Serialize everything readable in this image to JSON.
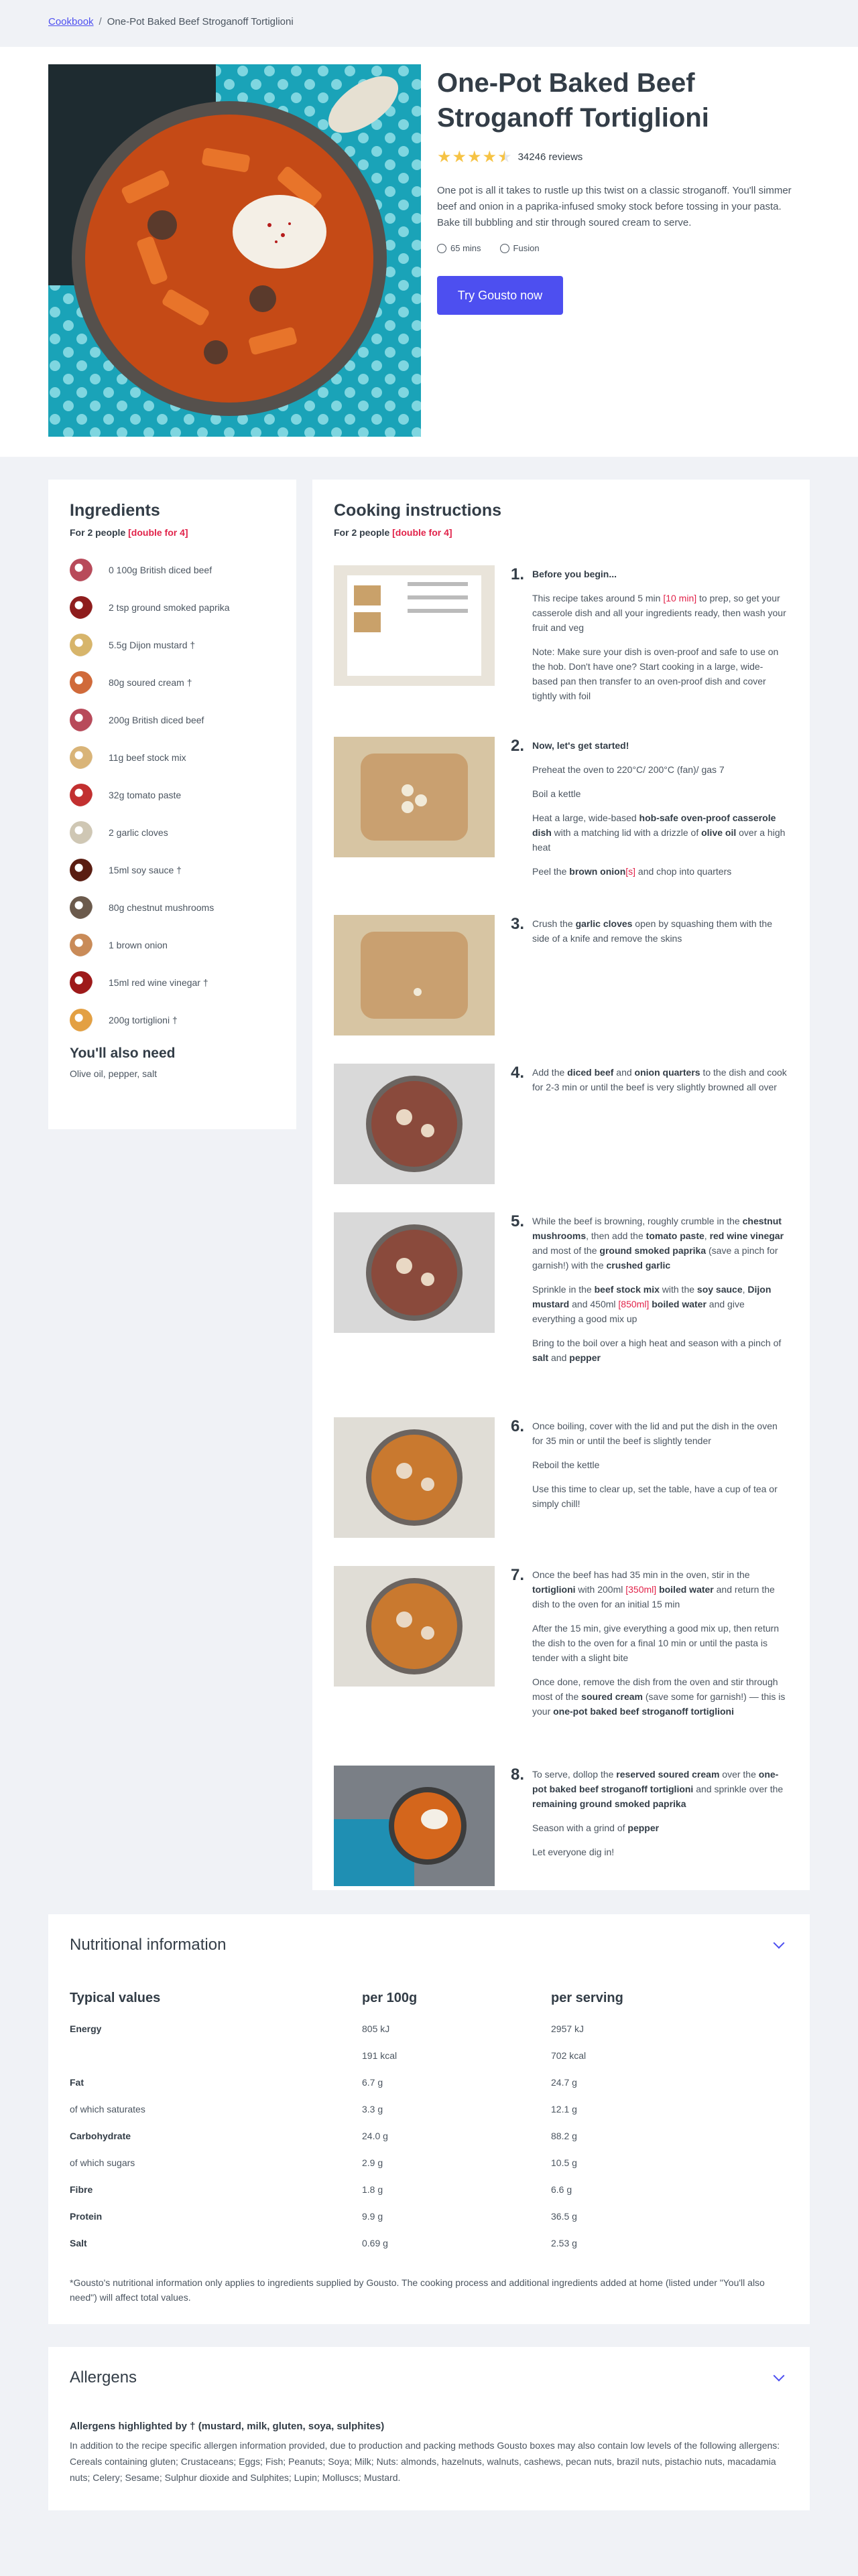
{
  "breadcrumb": {
    "link": "Cookbook",
    "separator": "/",
    "current": "One-Pot Baked Beef Stroganoff Tortiglioni"
  },
  "hero": {
    "title": "One-Pot Baked Beef Stroganoff Tortiglioni",
    "rating": 4.5,
    "reviews": "34246 reviews",
    "description": "One pot is all it takes to rustle up this twist on a classic stroganoff. You'll simmer beef and onion in a paprika-infused smoky stock before tossing in your pasta. Bake till bubbling and stir through soured cream to serve.",
    "time": "65 mins",
    "cuisine": "Fusion",
    "cta": "Try Gousto now"
  },
  "ingredients": {
    "title": "Ingredients",
    "serves": "For 2 people ",
    "double": "[double for 4]",
    "items": [
      {
        "label": "0 100g British diced beef",
        "color": "#b84a5a"
      },
      {
        "label": "2 tsp ground smoked paprika",
        "color": "#8e1d1d"
      },
      {
        "label": "5.5g Dijon mustard †",
        "color": "#d7b56b"
      },
      {
        "label": "80g soured cream †",
        "color": "#d06a3a"
      },
      {
        "label": "200g British diced beef",
        "color": "#b84a5a"
      },
      {
        "label": "11g beef stock mix",
        "color": "#d9b478"
      },
      {
        "label": "32g tomato paste",
        "color": "#c23030"
      },
      {
        "label": "2 garlic cloves",
        "color": "#cfc7b4"
      },
      {
        "label": "15ml soy sauce †",
        "color": "#5a1d12"
      },
      {
        "label": "80g chestnut mushrooms",
        "color": "#6b5a4c"
      },
      {
        "label": "1 brown onion",
        "color": "#c98b58"
      },
      {
        "label": "15ml red wine vinegar †",
        "color": "#9e1a1a"
      },
      {
        "label": "200g tortiglioni †",
        "color": "#e3a043"
      }
    ],
    "also_title": "You'll also need",
    "also_text": "Olive oil, pepper, salt"
  },
  "cooking": {
    "title": "Cooking instructions",
    "serves": "For 2 people ",
    "double": "[double for 4]",
    "steps": [
      {
        "num": "1.",
        "paras": [
          "<b>Before you begin...</b>",
          "This recipe takes around 5 min <span class='hl'>[10 min]</span> to prep, so get your casserole dish and all your ingredients ready, then wash your fruit and veg",
          "Note: Make sure your dish is oven-proof and safe to use on the hob. Don't have one? Start cooking in a large, wide-based pan then transfer to an oven-proof dish and cover tightly with foil"
        ]
      },
      {
        "num": "2.",
        "paras": [
          "<b>Now, let's get started!</b>",
          "Preheat the oven to 220°C/ 200°C (fan)/ gas 7",
          "Boil a kettle",
          "Heat a large, wide-based <b>hob-safe oven-proof casserole dish</b> with a matching lid with a drizzle of <b>olive oil</b> over a high heat",
          "Peel the <b>brown onion</b><span class='hl'>[s]</span> and chop into quarters"
        ]
      },
      {
        "num": "3.",
        "paras": [
          "Crush the <b>garlic cloves</b> open by squashing them with the side of a knife and remove the skins"
        ]
      },
      {
        "num": "4.",
        "paras": [
          "Add the <b>diced beef</b> and <b>onion quarters</b> to the dish and cook for 2-3 min or until the beef is very slightly browned all over"
        ]
      },
      {
        "num": "5.",
        "paras": [
          "While the beef is browning, roughly crumble in the <b>chestnut mushrooms</b>, then add the <b>tomato paste</b>, <b>red wine vinegar</b> and most of the <b>ground smoked paprika</b> (save a pinch for garnish!) with the <b>crushed garlic</b>",
          "Sprinkle in the <b>beef stock mix</b> with the <b>soy sauce</b>, <b>Dijon mustard</b> and 450ml <span class='hl'>[850ml]</span> <b>boiled water</b> and give everything a good mix up",
          "Bring to the boil over a high heat and season with a pinch of <b>salt</b> and <b>pepper</b>"
        ]
      },
      {
        "num": "6.",
        "paras": [
          "Once boiling, cover with the lid and put the dish in the oven for 35 min or until the beef is slightly tender",
          "Reboil the kettle",
          "Use this time to clear up, set the table, have a cup of tea or simply chill!"
        ]
      },
      {
        "num": "7.",
        "paras": [
          "Once the beef has had 35 min in the oven, stir in the <b>tortiglioni</b> with 200ml <span class='hl'>[350ml]</span> <b>boiled water</b> and return the dish to the oven for an initial 15 min",
          "After the 15 min, give everything a good mix up, then return the dish to the oven for a final 10 min or until the pasta is tender with a slight bite",
          "Once done, remove the dish from the oven and stir through most of the <b>soured cream</b> (save some for garnish!) — this is your <b>one-pot baked beef stroganoff tortiglioni</b>"
        ]
      },
      {
        "num": "8.",
        "paras": [
          "To serve, dollop the <b>reserved soured cream</b> over the <b>one-pot baked beef stroganoff tortiglioni</b> and sprinkle over the <b>remaining ground smoked paprika</b>",
          "Season with a grind of <b>pepper</b>",
          "Let everyone dig in!"
        ]
      }
    ]
  },
  "nutrition": {
    "title": "Nutritional information",
    "headers": [
      "Typical values",
      "per 100g",
      "per serving"
    ],
    "rows": [
      {
        "label": "Energy",
        "bold": true,
        "per100": "805 kJ",
        "serving": "2957 kJ"
      },
      {
        "label": "",
        "bold": false,
        "per100": "191 kcal",
        "serving": "702 kcal"
      },
      {
        "label": "Fat",
        "bold": true,
        "per100": "6.7 g",
        "serving": "24.7 g"
      },
      {
        "label": "of which saturates",
        "bold": false,
        "per100": "3.3 g",
        "serving": "12.1 g"
      },
      {
        "label": "Carbohydrate",
        "bold": true,
        "per100": "24.0 g",
        "serving": "88.2 g"
      },
      {
        "label": "of which sugars",
        "bold": false,
        "per100": "2.9 g",
        "serving": "10.5 g"
      },
      {
        "label": "Fibre",
        "bold": true,
        "per100": "1.8 g",
        "serving": "6.6 g"
      },
      {
        "label": "Protein",
        "bold": true,
        "per100": "9.9 g",
        "serving": "36.5 g"
      },
      {
        "label": "Salt",
        "bold": true,
        "per100": "0.69 g",
        "serving": "2.53 g"
      }
    ],
    "footnote": "*Gousto's nutritional information only applies to ingredients supplied by Gousto. The cooking process and additional ingredients added at home (listed under \"You'll also need\") will affect total values."
  },
  "allergens": {
    "title": "Allergens",
    "highlight": "Allergens highlighted by † (mustard, milk, gluten, soya, sulphites)",
    "text": "In addition to the recipe specific allergen information provided, due to production and packing methods Gousto boxes may also contain low levels of the following allergens: Cereals containing gluten; Crustaceans; Eggs; Fish; Peanuts; Soya; Milk; Nuts: almonds, hazelnuts, walnuts, cashews, pecan nuts, brazil nuts, pistachio nuts, macadamia nuts; Celery; Sesame; Sulphur dioxide and Sulphites; Lupin; Molluscs; Mustard."
  },
  "colors": {
    "accent": "#4d4ff0",
    "highlight": "#e1234a",
    "star": "#f6c344",
    "text": "#333d47"
  }
}
